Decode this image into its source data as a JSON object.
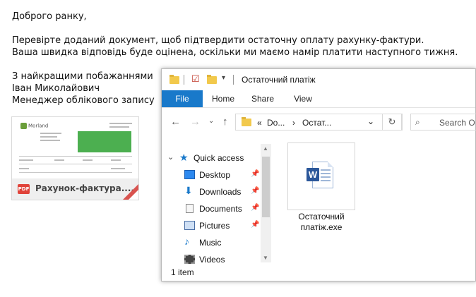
{
  "email": {
    "greeting": "Доброго ранку,",
    "line1": "Перевірте доданий документ, щоб підтвердити остаточну оплату рахунку-фактури.",
    "line2": "Ваша швидка відповідь буде оцінена, оскільки ми маємо намір платити наступного тижня.",
    "sign1": "З найкращими побажаннями",
    "sign2": "Іван Миколайович",
    "sign3": "Менеджер облікового запису"
  },
  "attachment": {
    "badge": "PDF",
    "name": "Рахунок-фактура....",
    "logo_text": "Morland"
  },
  "explorer": {
    "title": "Остаточний платіж",
    "ribbon": {
      "file": "File",
      "home": "Home",
      "share": "Share",
      "view": "View"
    },
    "address": {
      "prefix": "«",
      "seg1": "Do...",
      "sep": "›",
      "seg2": "Остат...",
      "dropdown": "⌄"
    },
    "search_placeholder": "Search O",
    "nav": {
      "quick_access": "Quick access",
      "items": [
        {
          "label": "Desktop",
          "icon": "desktop-icon",
          "pinned": true
        },
        {
          "label": "Downloads",
          "icon": "downloads-icon",
          "pinned": true
        },
        {
          "label": "Documents",
          "icon": "documents-icon",
          "pinned": true
        },
        {
          "label": "Pictures",
          "icon": "pictures-icon",
          "pinned": true
        },
        {
          "label": "Music",
          "icon": "music-icon",
          "pinned": false
        },
        {
          "label": "Videos",
          "icon": "videos-icon",
          "pinned": false
        }
      ]
    },
    "file": {
      "name": "Остаточний платіж.exe",
      "icon": "word-doc-icon"
    },
    "status": "1 item"
  }
}
